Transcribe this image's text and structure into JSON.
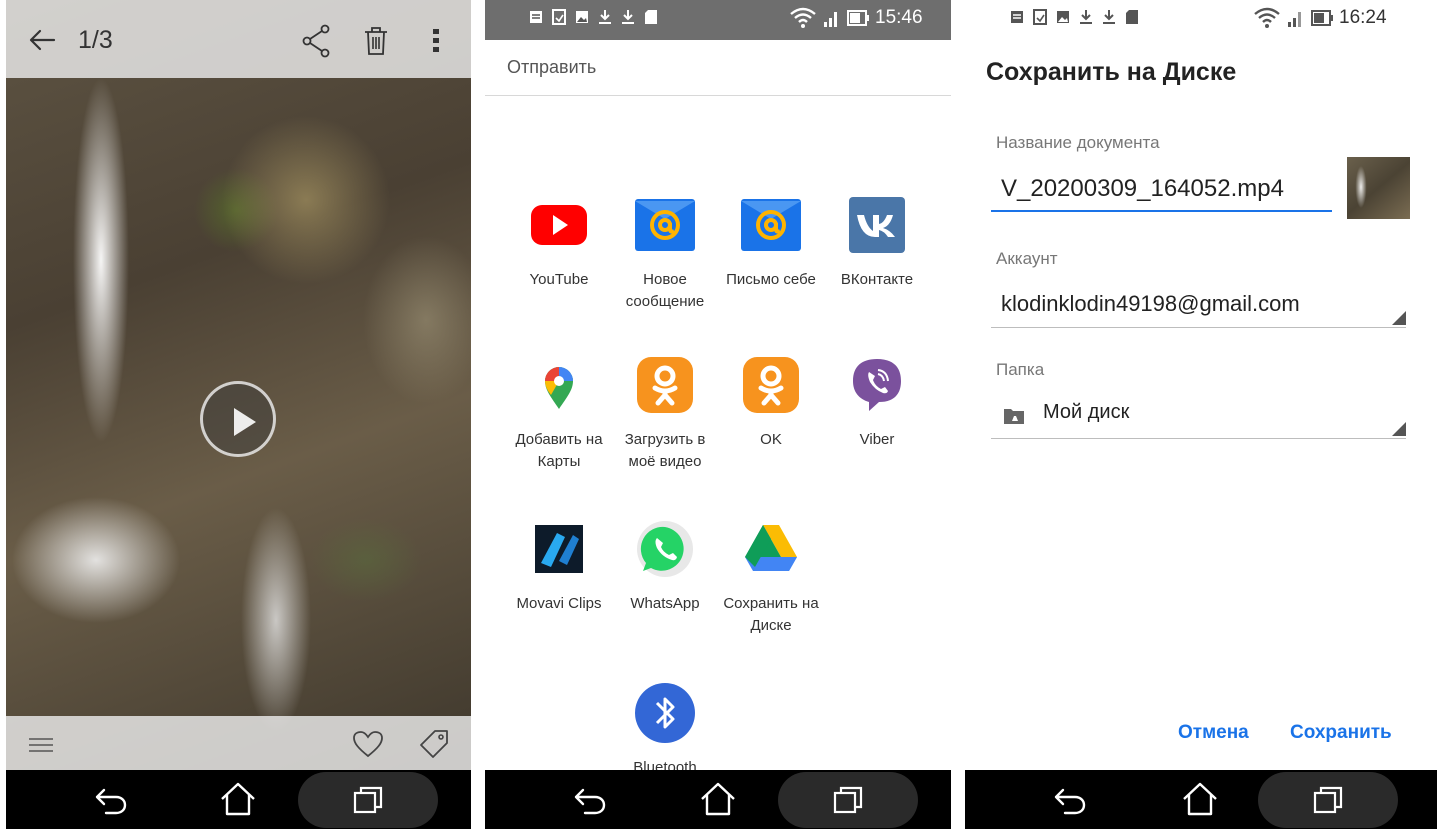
{
  "gallery": {
    "counter": "1/3",
    "icons": [
      "back-arrow-icon",
      "share-icon",
      "trash-icon",
      "more-vertical-icon",
      "play-icon",
      "menu-icon",
      "heart-icon",
      "tag-icon"
    ]
  },
  "share_sheet": {
    "status_time": "15:46",
    "title": "Отправить",
    "apps": [
      {
        "label": "YouTube"
      },
      {
        "label": "Новое сообщение"
      },
      {
        "label": "Письмо себе"
      },
      {
        "label": "ВКонтакте"
      },
      {
        "label": "Добавить на Карты"
      },
      {
        "label": "Загрузить в моё видео"
      },
      {
        "label": "OK"
      },
      {
        "label": "Viber"
      },
      {
        "label": "Movavi Clips"
      },
      {
        "label": "WhatsApp"
      },
      {
        "label": "Сохранить на Диске"
      },
      {
        "label": "Bluetooth"
      }
    ]
  },
  "save_drive": {
    "status_time": "16:24",
    "title": "Сохранить на Диске",
    "doc_label": "Название документа",
    "doc_value": "V_20200309_164052.mp4",
    "account_label": "Аккаунт",
    "account_value": "klodinklodin49198@gmail.com",
    "folder_label": "Папка",
    "folder_value": "Мой диск",
    "cancel": "Отмена",
    "save": "Сохранить"
  },
  "colors": {
    "accent": "#1a73e8",
    "youtube": "#ff0000",
    "mail": "#1a73e8",
    "vk": "#4a76a8",
    "ok": "#f7931e",
    "viber": "#7b519d",
    "whatsapp": "#25d366",
    "bluetooth": "#3367d6"
  }
}
